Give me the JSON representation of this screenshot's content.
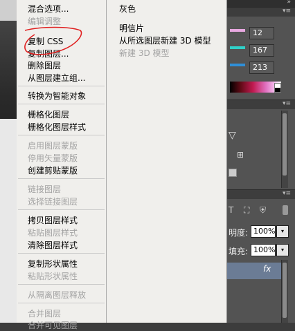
{
  "menu": {
    "items": [
      {
        "label": "混合选项...",
        "enabled": true
      },
      {
        "label": "编辑调整",
        "enabled": false
      },
      {
        "label": "复制 CSS",
        "enabled": true
      },
      {
        "label": "复制图层...",
        "enabled": true
      },
      {
        "label": "删除图层",
        "enabled": true
      },
      {
        "label": "从图层建立组...",
        "enabled": true
      },
      {
        "label": "转换为智能对象",
        "enabled": true
      },
      {
        "label": "栅格化图层",
        "enabled": true
      },
      {
        "label": "栅格化图层样式",
        "enabled": true
      },
      {
        "label": "启用图层蒙版",
        "enabled": false
      },
      {
        "label": "停用矢量蒙版",
        "enabled": false
      },
      {
        "label": "创建剪贴蒙版",
        "enabled": true
      },
      {
        "label": "链接图层",
        "enabled": false
      },
      {
        "label": "选择链接图层",
        "enabled": false
      },
      {
        "label": "拷贝图层样式",
        "enabled": true
      },
      {
        "label": "粘贴图层样式",
        "enabled": false
      },
      {
        "label": "清除图层样式",
        "enabled": true
      },
      {
        "label": "复制形状属性",
        "enabled": true
      },
      {
        "label": "粘贴形状属性",
        "enabled": false
      },
      {
        "label": "从隔离图层释放",
        "enabled": false
      },
      {
        "label": "合并图层",
        "enabled": false
      },
      {
        "label": "合并可见图层",
        "enabled": false
      }
    ]
  },
  "submenu": {
    "items": [
      {
        "label": "灰色",
        "enabled": true
      },
      {
        "label": "明信片",
        "enabled": true
      },
      {
        "label": "从所选图层新建 3D 模型",
        "enabled": true
      },
      {
        "label": "新建 3D 模型",
        "enabled": false
      }
    ]
  },
  "color_panel": {
    "values": [
      "12",
      "167",
      "213"
    ],
    "slider_colors": [
      "#e8a8e0",
      "#30d0c8",
      "#2f8fd8"
    ]
  },
  "layers_panel": {
    "opacity_label": "明度:",
    "opacity_value": "100%",
    "fill_label": "填充:",
    "fill_value": "100%",
    "fx_label": "fx"
  },
  "colors": {
    "menu_bg": "#f0efec",
    "disabled_text": "#a3a3a3",
    "panel_bg": "#535353",
    "selected_layer": "#6b7c95",
    "annotation_red": "#e02020"
  }
}
